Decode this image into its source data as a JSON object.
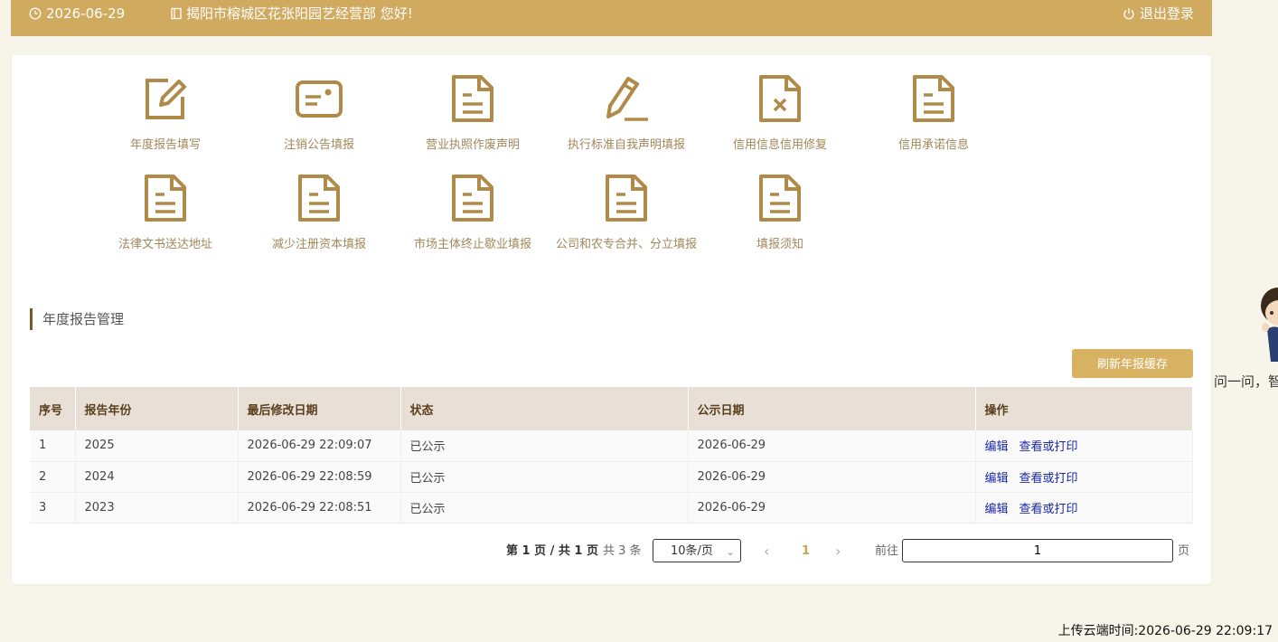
{
  "header": {
    "date": "2026-06-29",
    "greeting": "揭阳市榕城区花张阳园艺经营部 您好!",
    "logout_label": "退出登录",
    "clock_icon": "clock-icon",
    "logout_icon": "power-icon",
    "bg_color": "#d0aa5e"
  },
  "menu": {
    "items": [
      {
        "label": "年度报告填写",
        "icon": "edit-icon"
      },
      {
        "label": "注销公告填报",
        "icon": "id-card-icon"
      },
      {
        "label": "营业执照作废声明",
        "icon": "document-icon"
      },
      {
        "label": "执行标准自我声明填报",
        "icon": "pencil-icon"
      },
      {
        "label": "信用信息信用修复",
        "icon": "document-x-icon"
      },
      {
        "label": "信用承诺信息",
        "icon": "document-icon"
      },
      {
        "label": "法律文书送达地址",
        "icon": "document-icon"
      },
      {
        "label": "减少注册资本填报",
        "icon": "document-icon"
      },
      {
        "label": "市场主体终止歇业填报",
        "icon": "document-icon"
      },
      {
        "label": "公司和农专合并、分立填报",
        "icon": "document-icon"
      },
      {
        "label": "填报须知",
        "icon": "document-icon"
      }
    ],
    "icon_color": "#b08a48"
  },
  "section": {
    "title": "年度报告管理",
    "refresh_label": "刷新年报缓存"
  },
  "table": {
    "headers": [
      "序号",
      "报告年份",
      "最后修改日期",
      "状态",
      "公示日期",
      "操作"
    ],
    "rows": [
      {
        "no": "1",
        "year": "2025",
        "modified": "2026-06-29 22:09:07",
        "status": "已公示",
        "publish": "2026-06-29",
        "edit": "编辑",
        "view": "查看或打印"
      },
      {
        "no": "2",
        "year": "2024",
        "modified": "2026-06-29 22:08:59",
        "status": "已公示",
        "publish": "2026-06-29",
        "edit": "编辑",
        "view": "查看或打印"
      },
      {
        "no": "3",
        "year": "2023",
        "modified": "2026-06-29 22:08:51",
        "status": "已公示",
        "publish": "2026-06-29",
        "edit": "编辑",
        "view": "查看或打印"
      }
    ]
  },
  "pager": {
    "page_info": "第 1 页 / 共 1 页",
    "total": "共 3 条",
    "page_size": "10条/页",
    "current": "1",
    "goto_label": "前往",
    "goto_value": "1",
    "page_unit": "页"
  },
  "footer": {
    "upload_time": "上传云端时间:2026-06-29 22:09:17",
    "assistant_text": "问一问，智"
  }
}
